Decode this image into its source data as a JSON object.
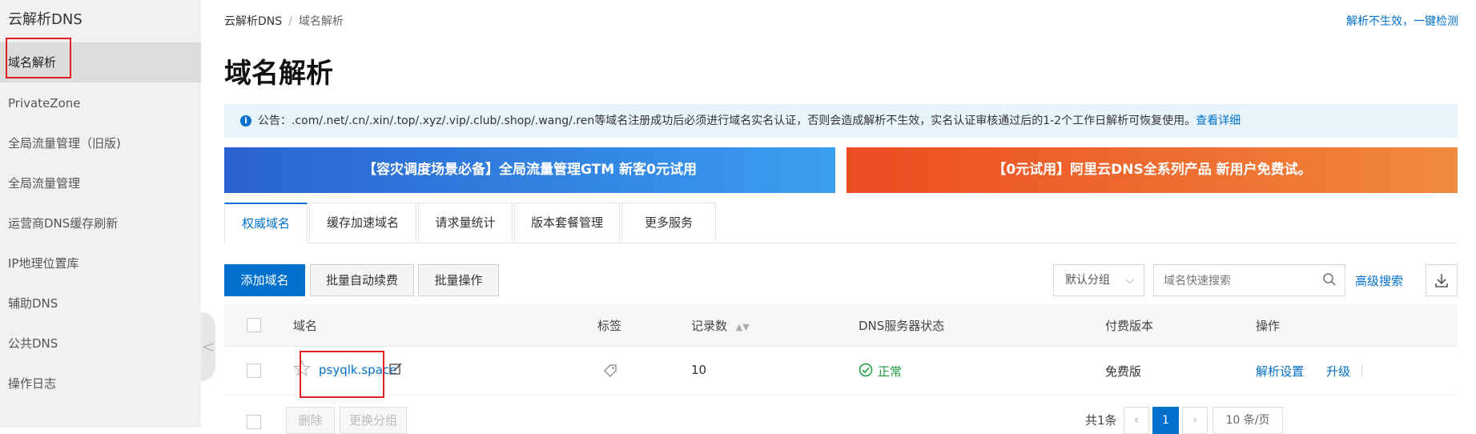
{
  "sidebar": {
    "title": "云解析DNS",
    "items": [
      {
        "label": "域名解析"
      },
      {
        "label": "PrivateZone"
      },
      {
        "label": "全局流量管理（旧版)"
      },
      {
        "label": "全局流量管理"
      },
      {
        "label": "运营商DNS缓存刷新"
      },
      {
        "label": "IP地理位置库"
      },
      {
        "label": "辅助DNS"
      },
      {
        "label": "公共DNS"
      },
      {
        "label": "操作日志"
      }
    ],
    "collapse_glyph": "<"
  },
  "breadcrumb": {
    "root": "云解析DNS",
    "sep": "/",
    "current": "域名解析"
  },
  "top_link": "解析不生效，一键检测",
  "page_title": "域名解析",
  "notice": {
    "text": "公告：.com/.net/.cn/.xin/.top/.xyz/.vip/.club/.shop/.wang/.ren等域名注册成功后必须进行域名实名认证，否则会造成解析不生效，实名认证审核通过后的1-2个工作日解析可恢复使用。",
    "link": "查看详细"
  },
  "banners": [
    {
      "text": "【容灾调度场景必备】全局流量管理GTM 新客0元试用"
    },
    {
      "text": "【0元试用】阿里云DNS全系列产品 新用户免费试。"
    }
  ],
  "tabs": [
    {
      "label": "权威域名"
    },
    {
      "label": "缓存加速域名"
    },
    {
      "label": "请求量统计"
    },
    {
      "label": "版本套餐管理"
    },
    {
      "label": "更多服务"
    }
  ],
  "toolbar": {
    "add": "添加域名",
    "renew": "批量自动续费",
    "batch": "批量操作",
    "group_select": "默认分组",
    "search_placeholder": "域名快速搜索",
    "advanced": "高级搜索"
  },
  "table": {
    "headers": {
      "domain": "域名",
      "tag": "标签",
      "records": "记录数",
      "dns_status": "DNS服务器状态",
      "edition": "付费版本",
      "ops": "操作"
    },
    "rows": [
      {
        "domain": "psyqlk.space",
        "records": "10",
        "dns_status": "正常",
        "edition": "免费版",
        "op1": "解析设置",
        "op2": "升级",
        "op_sep": "|"
      }
    ]
  },
  "footer": {
    "delete": "删除",
    "change_group": "更换分组",
    "total": "共1条",
    "page": "1",
    "page_size": "10 条/页"
  },
  "colors": {
    "accent": "#0070cc",
    "ok": "#1a9c3e",
    "highlight": "#e02020"
  }
}
